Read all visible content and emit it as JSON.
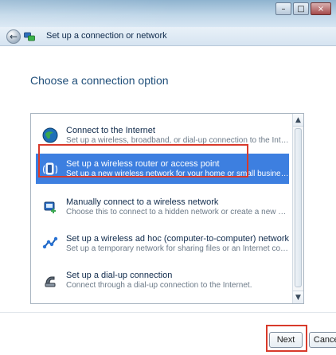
{
  "window": {
    "controls": {
      "minimize": "–",
      "maximize": "□",
      "close": "×"
    }
  },
  "nav": {
    "title": "Set up a connection or network"
  },
  "page": {
    "heading": "Choose a connection option"
  },
  "options": [
    {
      "title": "Connect to the Internet",
      "description": "Set up a wireless, broadband, or dial-up connection to the Internet.",
      "icon": "globe-icon"
    },
    {
      "title": "Set up a wireless router or access point",
      "description": "Set up a new wireless network for your home or small business.",
      "icon": "router-icon",
      "selected": true
    },
    {
      "title": "Manually connect to a wireless network",
      "description": "Choose this to connect to a hidden network or create a new wireless profile.",
      "icon": "wireless-profile-icon"
    },
    {
      "title": "Set up a wireless ad hoc (computer-to-computer) network",
      "description": "Set up a temporary network for sharing files or an Internet connection.",
      "icon": "adhoc-network-icon"
    },
    {
      "title": "Set up a dial-up connection",
      "description": "Connect through a dial-up connection to the Internet.",
      "icon": "phone-icon"
    }
  ],
  "footer": {
    "next_label": "Next",
    "cancel_label": "Cancel"
  },
  "colors": {
    "selection": "#3d7fe0",
    "highlight": "#d83a2b",
    "heading": "#1f4e79"
  }
}
